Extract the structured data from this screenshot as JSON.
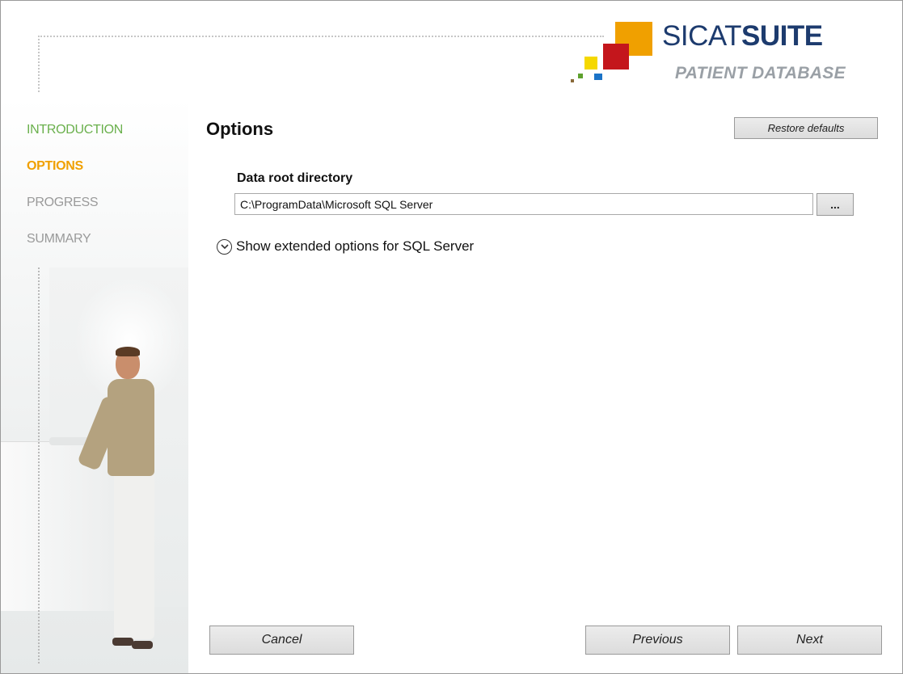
{
  "brand": {
    "logo_title_thin": "SICAT",
    "logo_title_bold": "SUITE",
    "logo_subtitle": "PATIENT DATABASE",
    "colors": {
      "orange": "#f0a000",
      "red": "#c4161c",
      "yellow": "#f5d800",
      "blue": "#1b73c7",
      "green": "#5ea12e",
      "navy": "#1d3b6e"
    }
  },
  "steps": [
    {
      "label": "INTRODUCTION",
      "state": "done"
    },
    {
      "label": "OPTIONS",
      "state": "active"
    },
    {
      "label": "PROGRESS",
      "state": "pending"
    },
    {
      "label": "SUMMARY",
      "state": "pending"
    }
  ],
  "main": {
    "title": "Options",
    "restore_label": "Restore defaults",
    "data_root_label": "Data root directory",
    "data_root_value": "C:\\ProgramData\\Microsoft SQL Server",
    "browse_label": "...",
    "expander_label": "Show extended options for SQL Server",
    "expander_icon": "chevron-down-circle-icon"
  },
  "footer": {
    "cancel_label": "Cancel",
    "previous_label": "Previous",
    "next_label": "Next"
  },
  "sidebar_image": "photo-man-at-counter"
}
